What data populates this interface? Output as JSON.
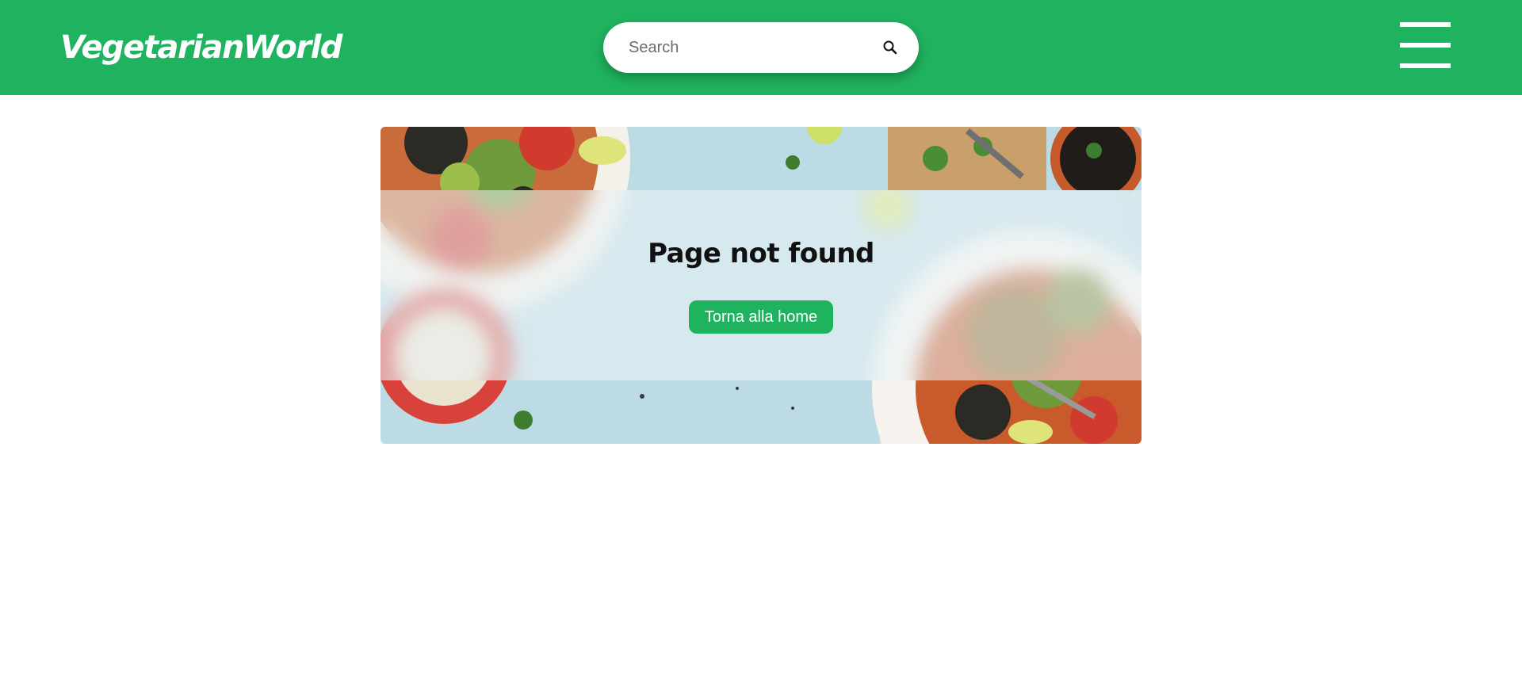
{
  "header": {
    "logo_text": "VegetarianWorld",
    "search": {
      "placeholder": "Search",
      "value": "",
      "icon": "search-icon"
    },
    "menu_icon": "hamburger-icon"
  },
  "main": {
    "title": "Page not found",
    "home_button_label": "Torna alla home"
  },
  "colors": {
    "brand_green": "#1fb35f",
    "background": "#ffffff",
    "title_text": "#111111"
  }
}
